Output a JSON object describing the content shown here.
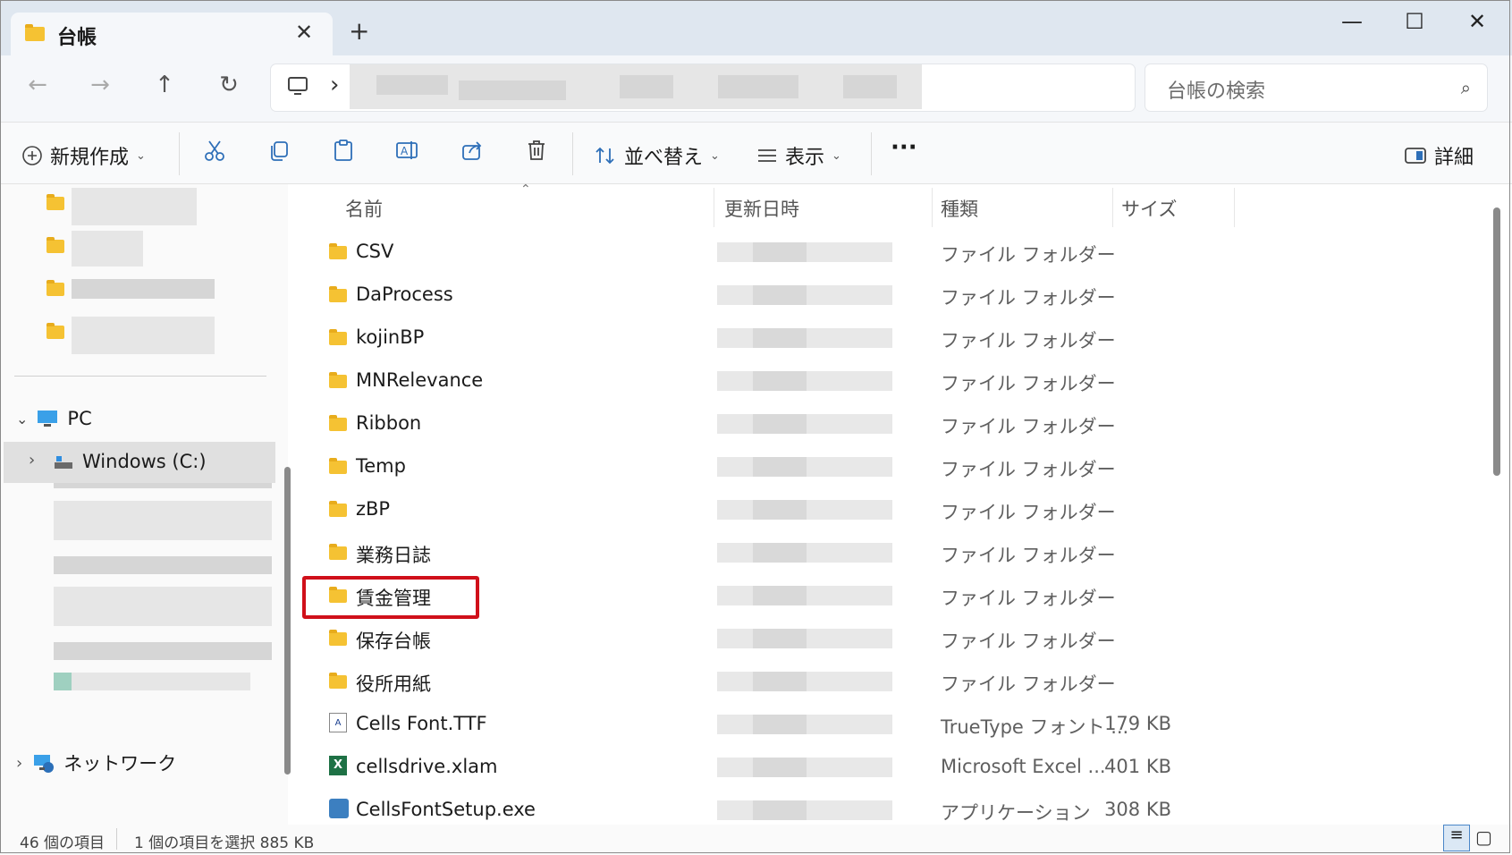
{
  "window": {
    "tab_title": "台帳",
    "tab_close": "✕",
    "new_tab": "+",
    "minimize": "—",
    "maximize": "☐",
    "close": "✕"
  },
  "nav": {
    "back": "←",
    "forward": "→",
    "up": "↑",
    "refresh": "↻",
    "computer_icon": "computer-icon",
    "chevron": "›"
  },
  "search": {
    "placeholder": "台帳の検索",
    "icon": "⌕"
  },
  "toolbar": {
    "new_label": "新規作成",
    "sort_label": "並べ替え",
    "view_label": "表示",
    "more": "···",
    "details_label": "詳細"
  },
  "navpane": {
    "pc_label": "PC",
    "drive_label": "Windows (C:)",
    "network_label": "ネットワーク"
  },
  "columns": {
    "name": "名前",
    "modified": "更新日時",
    "type": "種類",
    "size": "サイズ"
  },
  "files": [
    {
      "name": "CSV",
      "type": "ファイル フォルダー",
      "size": "",
      "kind": "folder"
    },
    {
      "name": "DaProcess",
      "type": "ファイル フォルダー",
      "size": "",
      "kind": "folder"
    },
    {
      "name": "kojinBP",
      "type": "ファイル フォルダー",
      "size": "",
      "kind": "folder"
    },
    {
      "name": "MNRelevance",
      "type": "ファイル フォルダー",
      "size": "",
      "kind": "folder"
    },
    {
      "name": "Ribbon",
      "type": "ファイル フォルダー",
      "size": "",
      "kind": "folder"
    },
    {
      "name": "Temp",
      "type": "ファイル フォルダー",
      "size": "",
      "kind": "folder"
    },
    {
      "name": "zBP",
      "type": "ファイル フォルダー",
      "size": "",
      "kind": "folder"
    },
    {
      "name": "業務日誌",
      "type": "ファイル フォルダー",
      "size": "",
      "kind": "folder"
    },
    {
      "name": "賃金管理",
      "type": "ファイル フォルダー",
      "size": "",
      "kind": "folder",
      "highlighted": true
    },
    {
      "name": "保存台帳",
      "type": "ファイル フォルダー",
      "size": "",
      "kind": "folder"
    },
    {
      "name": "役所用紙",
      "type": "ファイル フォルダー",
      "size": "",
      "kind": "folder"
    },
    {
      "name": "Cells Font.TTF",
      "type": "TrueType フォント ...",
      "size": "179 KB",
      "kind": "ttf"
    },
    {
      "name": "cellsdrive.xlam",
      "type": "Microsoft Excel ...",
      "size": "401 KB",
      "kind": "xlam"
    },
    {
      "name": "CellsFontSetup.exe",
      "type": "アプリケーション",
      "size": "308 KB",
      "kind": "exe"
    }
  ],
  "status": {
    "count": "46 個の項目",
    "selection": "1 個の項目を選択  885 KB"
  },
  "colors": {
    "highlight_border": "#d0101a",
    "folder": "#f5c233",
    "accent": "#2e6fb8"
  }
}
